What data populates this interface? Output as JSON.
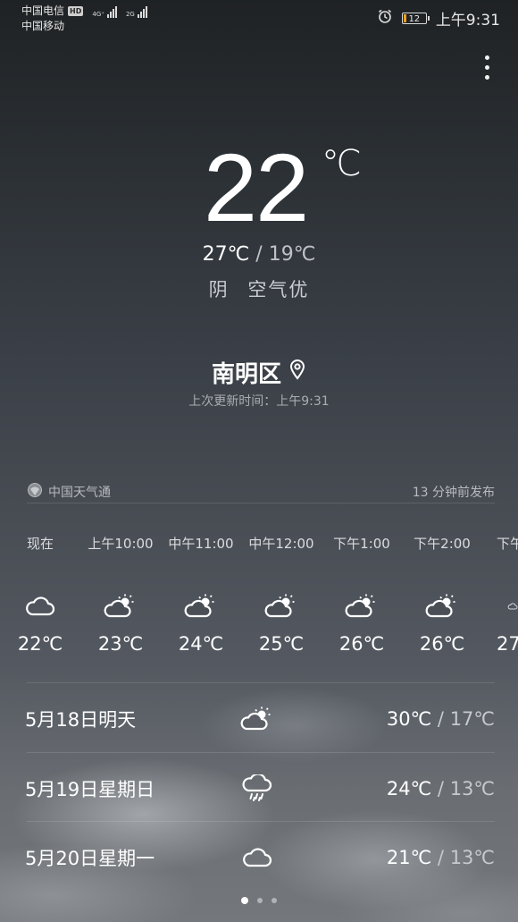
{
  "status_bar": {
    "carrier1": "中国电信",
    "hd_badge": "HD",
    "net1": "4G⁺",
    "carrier2": "中国移动",
    "net2": "2G",
    "battery": "12",
    "battery_fraction": 0.12,
    "battery_color": "#f0a020",
    "time": "上午9:31",
    "alarm_icon": "alarm-clock-icon"
  },
  "current": {
    "temp": "22",
    "unit": "℃",
    "high": "27℃",
    "separator": "/",
    "low": "19℃",
    "condition": "阴",
    "air": "空气优"
  },
  "location": {
    "city": "南明区",
    "location_icon": "location-pin-icon",
    "updated": "上次更新时间：上午9:31"
  },
  "source": {
    "provider": "中国天气通",
    "published": "13 分钟前发布"
  },
  "hourly": [
    {
      "time": "现在",
      "icon": "cloud-icon",
      "temp": "22℃"
    },
    {
      "time": "上午10:00",
      "icon": "partly-cloudy-icon",
      "temp": "23℃"
    },
    {
      "time": "中午11:00",
      "icon": "partly-cloudy-icon",
      "temp": "24℃"
    },
    {
      "time": "中午12:00",
      "icon": "partly-cloudy-icon",
      "temp": "25℃"
    },
    {
      "time": "下午1:00",
      "icon": "partly-cloudy-icon",
      "temp": "26℃"
    },
    {
      "time": "下午2:00",
      "icon": "partly-cloudy-icon",
      "temp": "26℃"
    },
    {
      "time": "下午",
      "icon": "cloud-icon",
      "temp": "27"
    }
  ],
  "daily": [
    {
      "date": "5月18日明天",
      "icon": "partly-cloudy-icon",
      "high": "30℃",
      "sep": "/",
      "low": "17℃"
    },
    {
      "date": "5月19日星期日",
      "icon": "rain-icon",
      "high": "24℃",
      "sep": "/",
      "low": "13℃"
    },
    {
      "date": "5月20日星期一",
      "icon": "cloud-icon",
      "high": "21℃",
      "sep": "/",
      "low": "13℃"
    }
  ],
  "pager": {
    "pages": 3,
    "active": 1
  }
}
